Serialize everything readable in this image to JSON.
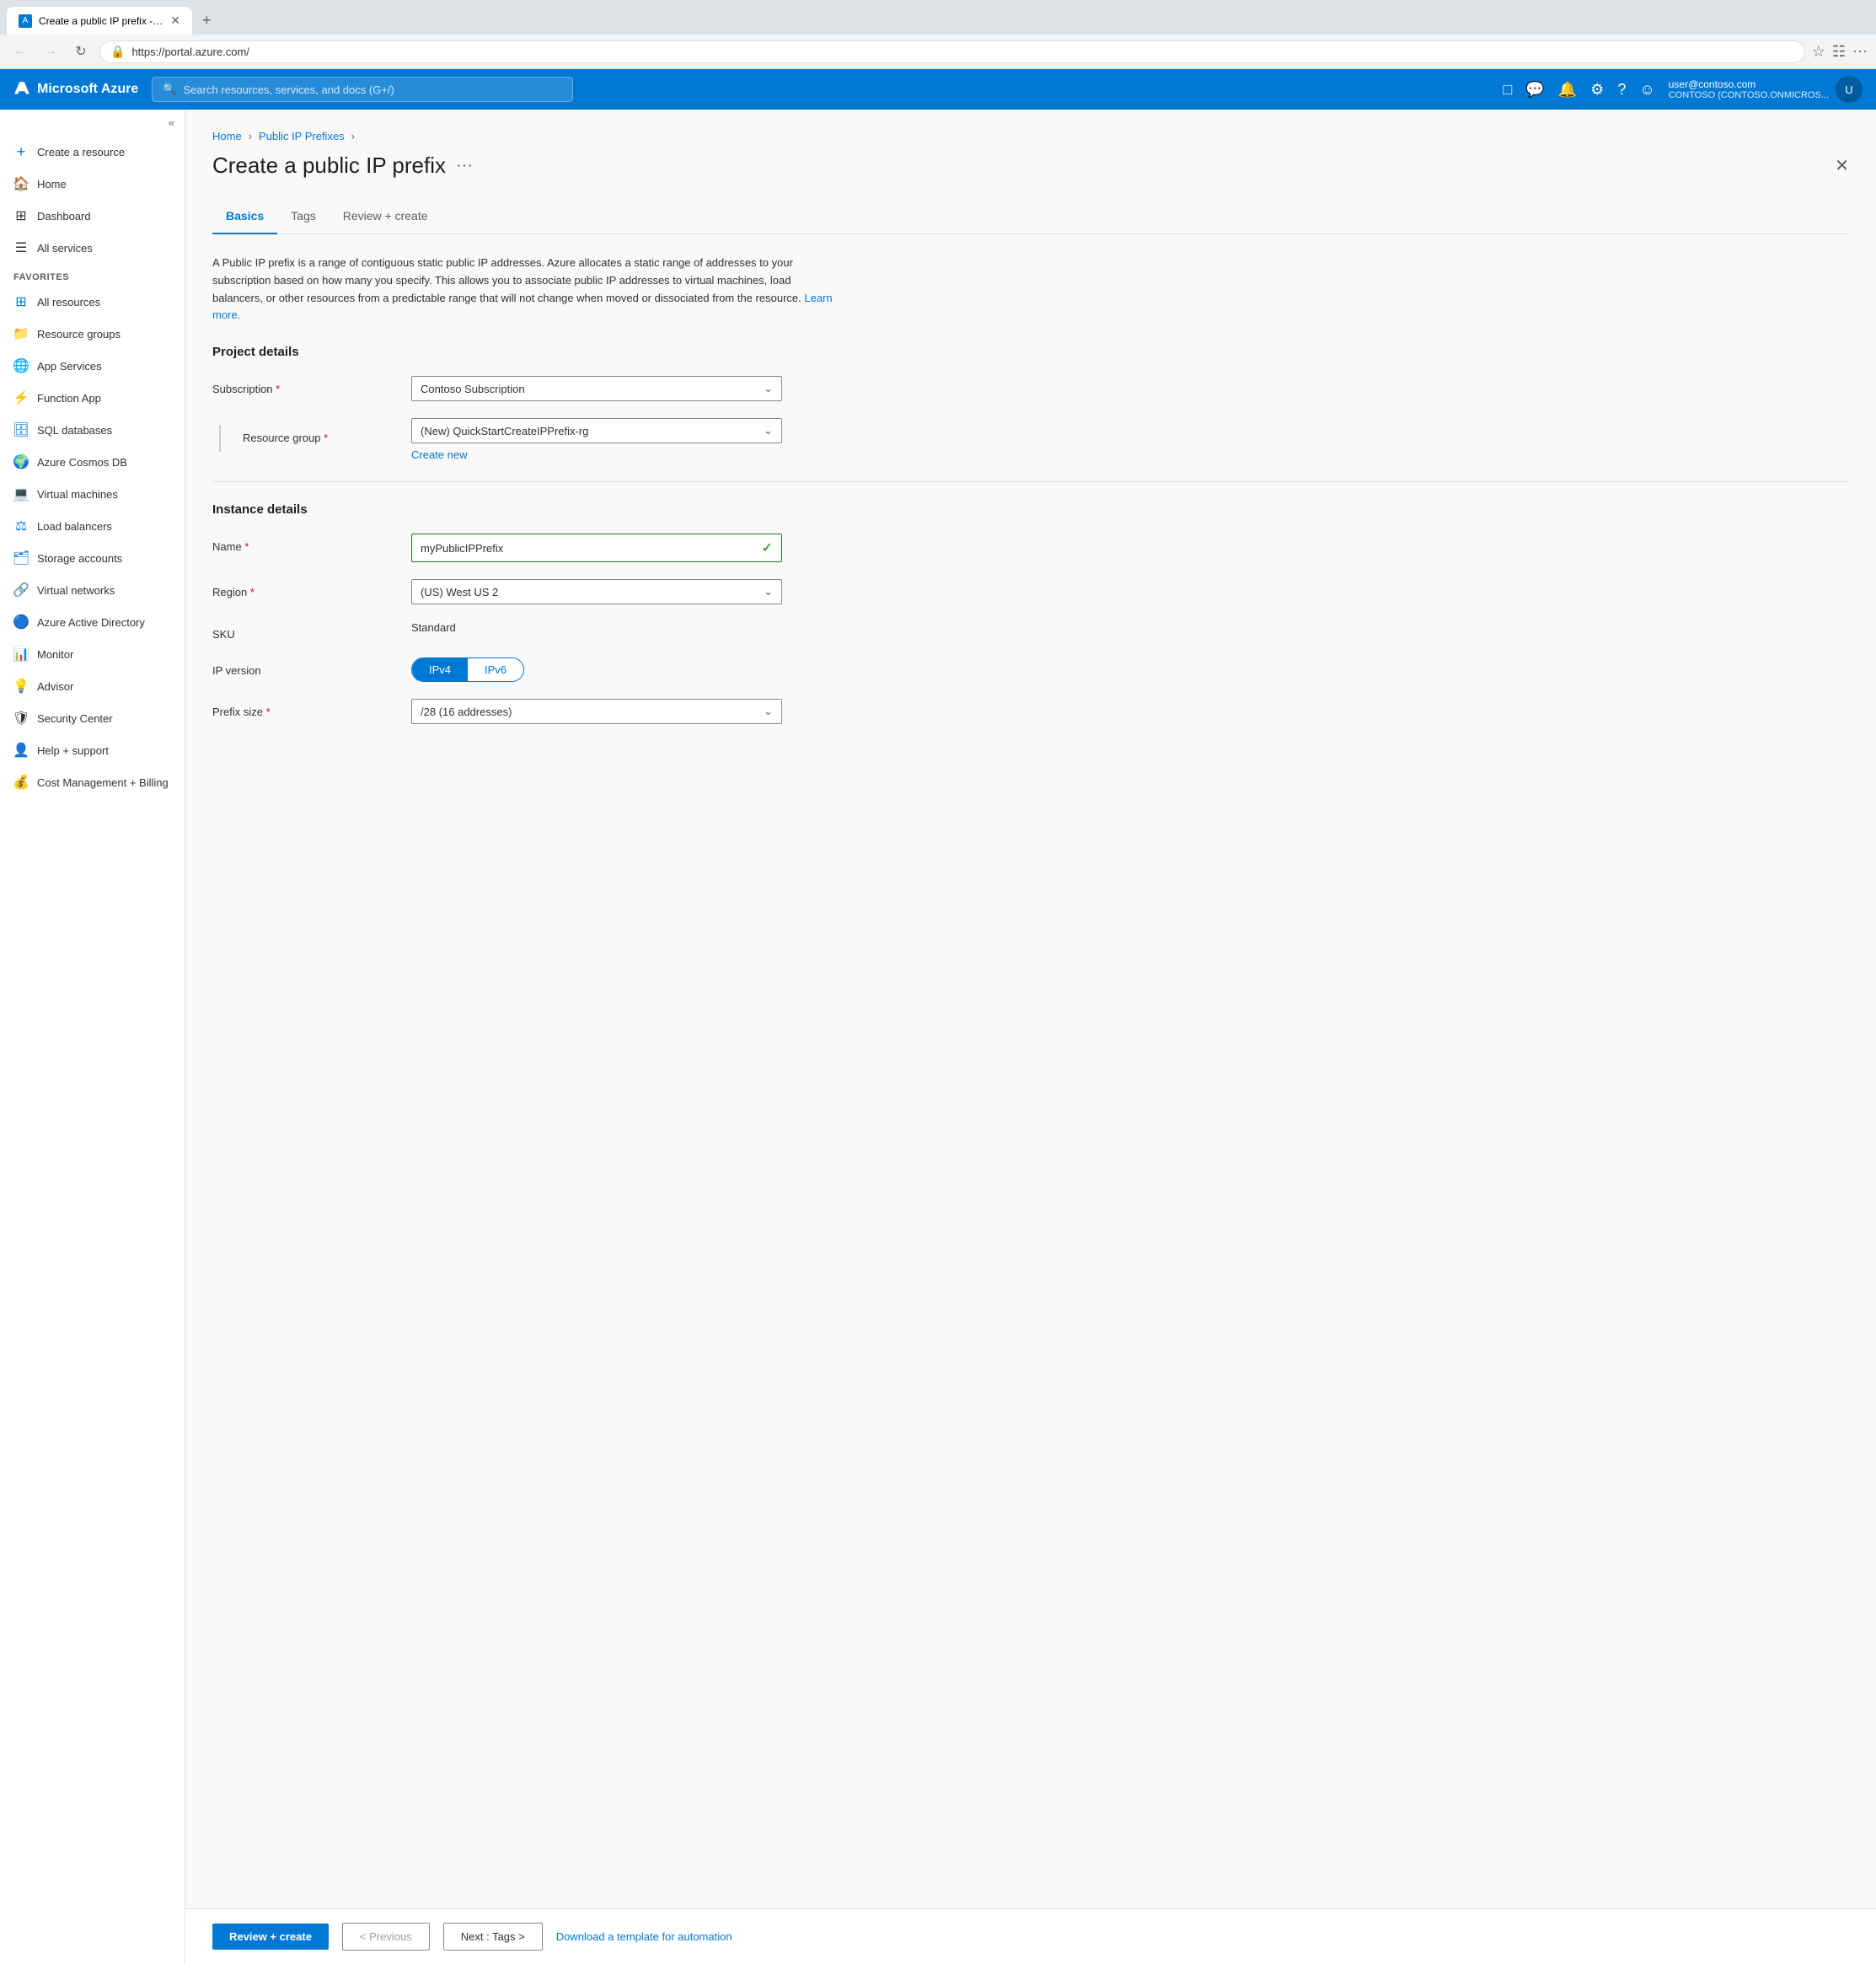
{
  "browser": {
    "tab_label": "Create a public IP prefix - Micr...",
    "tab_icon": "A",
    "url": "https://portal.azure.com/",
    "new_tab_icon": "+"
  },
  "header": {
    "logo": "Microsoft Azure",
    "search_placeholder": "Search resources, services, and docs (G+/)",
    "user_email": "user@contoso.com",
    "user_org": "CONTOSO (CONTOSO.ONMICROS...",
    "user_initial": "U"
  },
  "sidebar": {
    "collapse_icon": "«",
    "create_resource": "Create a resource",
    "home": "Home",
    "dashboard": "Dashboard",
    "all_services": "All services",
    "favorites_label": "FAVORITES",
    "all_resources": "All resources",
    "resource_groups": "Resource groups",
    "app_services": "App Services",
    "function_app": "Function App",
    "sql_databases": "SQL databases",
    "azure_cosmos_db": "Azure Cosmos DB",
    "virtual_machines": "Virtual machines",
    "load_balancers": "Load balancers",
    "storage_accounts": "Storage accounts",
    "virtual_networks": "Virtual networks",
    "azure_active_directory": "Azure Active Directory",
    "monitor": "Monitor",
    "advisor": "Advisor",
    "security_center": "Security Center",
    "help_support": "Help + support",
    "cost_management": "Cost Management + Billing"
  },
  "breadcrumb": {
    "home": "Home",
    "public_ip_prefixes": "Public IP Prefixes"
  },
  "page": {
    "title": "Create a public IP prefix",
    "more_icon": "···",
    "close_icon": "✕"
  },
  "tabs": [
    {
      "id": "basics",
      "label": "Basics",
      "active": true
    },
    {
      "id": "tags",
      "label": "Tags",
      "active": false
    },
    {
      "id": "review_create",
      "label": "Review + create",
      "active": false
    }
  ],
  "description": {
    "text": "A Public IP prefix is a range of contiguous static public IP addresses. Azure allocates a static range of addresses to your subscription based on how many you specify. This allows you to associate public IP addresses to virtual machines, load balancers, or other resources from a predictable range that will not change when moved or dissociated from the resource.",
    "learn_more": "Learn more."
  },
  "form": {
    "project_details_title": "Project details",
    "subscription_label": "Subscription",
    "subscription_value": "Contoso Subscription",
    "resource_group_label": "Resource group",
    "resource_group_value": "(New) QuickStartCreateIPPrefix-rg",
    "create_new_label": "Create new",
    "instance_details_title": "Instance details",
    "name_label": "Name",
    "name_value": "myPublicIPPrefix",
    "region_label": "Region",
    "region_value": "(US) West US 2",
    "sku_label": "SKU",
    "sku_value": "Standard",
    "ip_version_label": "IP version",
    "ip_version_ipv4": "IPv4",
    "ip_version_ipv6": "IPv6",
    "prefix_size_label": "Prefix size",
    "prefix_size_value": "/28 (16 addresses)"
  },
  "footer": {
    "review_create_label": "Review + create",
    "previous_label": "< Previous",
    "next_label": "Next : Tags >",
    "download_label": "Download a template for automation"
  }
}
